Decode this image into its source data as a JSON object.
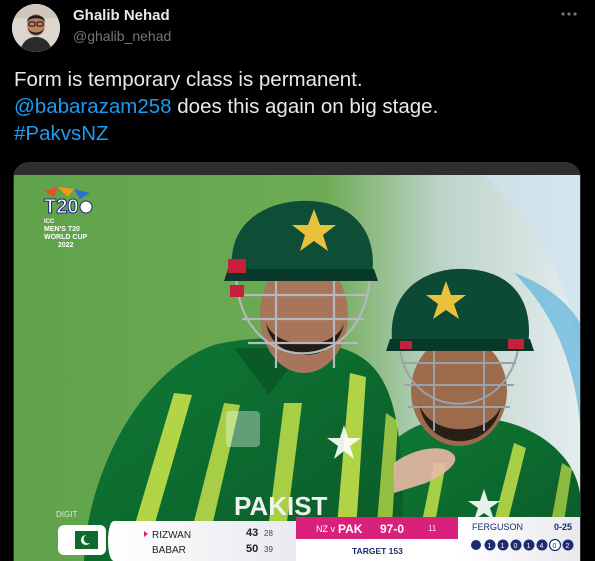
{
  "author": {
    "name": "Ghalib Nehad",
    "handle": "@ghalib_nehad"
  },
  "tweet": {
    "line1": "Form is temporary class is permanent.",
    "mention": "@babarazam258",
    "line2_rest": " does this again on big stage.",
    "hashtag": "#PakvsNZ"
  },
  "icons": {
    "more": "more-horizontal-icon"
  },
  "media": {
    "logo": {
      "line1": "ICC",
      "line2": "MEN'S T20",
      "line3": "WORLD CUP",
      "line4": "2022"
    },
    "shirt_text": "PAKIST",
    "digital_text": "DIGIT",
    "scoreboard": {
      "batter1_name": "RIZWAN",
      "batter1_runs": "43",
      "batter1_balls": "28",
      "batter2_name": "BABAR",
      "batter2_runs": "50",
      "batter2_balls": "39",
      "match_label": "NZ v",
      "team": "PAK",
      "score": "97-0",
      "overs": "11",
      "target": "TARGET 153",
      "bowler_name": "FERGUSON",
      "bowler_figures": "0-25",
      "recent_balls": [
        "1",
        "1",
        "0",
        "1",
        "4",
        "0",
        "2"
      ]
    },
    "colors": {
      "pak_green": "#0e6b2c",
      "scoreboard_pink": "#d9207a",
      "scoreboard_navy": "#1c2c6e"
    }
  }
}
